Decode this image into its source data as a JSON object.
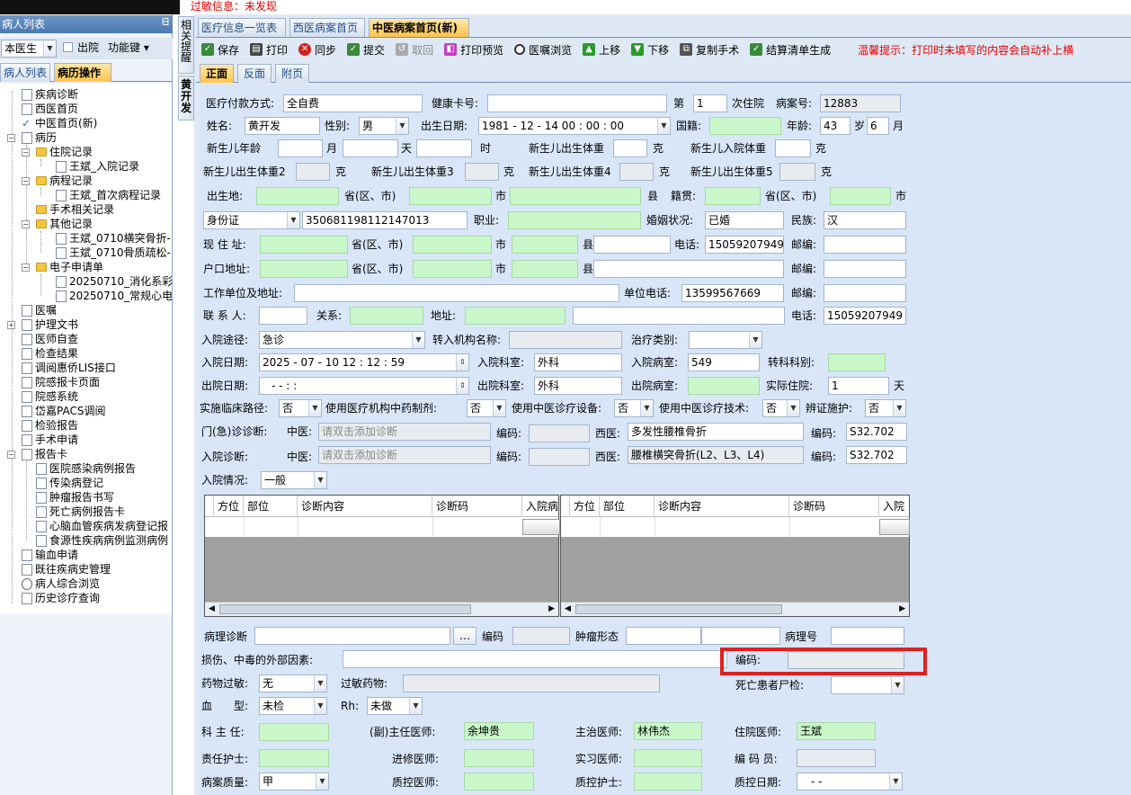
{
  "top": {
    "allergy_info": "过敏信息：未发现"
  },
  "left_panel": {
    "title": "病人列表",
    "doctor_filter": "本医生",
    "discharge_label": "出院",
    "function_key": "功能键",
    "tabs": [
      "病人列表",
      "病历操作"
    ],
    "tree": [
      {
        "label": "疾病诊断"
      },
      {
        "label": "西医首页"
      },
      {
        "label": "中医首页(新)"
      },
      {
        "label": "病历"
      },
      {
        "label": "住院记录"
      },
      {
        "label": "王斌_入院记录"
      },
      {
        "label": "病程记录"
      },
      {
        "label": "王斌_首次病程记录"
      },
      {
        "label": "手术相关记录"
      },
      {
        "label": "其他记录"
      },
      {
        "label": "王斌_0710横突骨折-"
      },
      {
        "label": "王斌_0710骨质疏松-|"
      },
      {
        "label": "电子申请单"
      },
      {
        "label": "20250710_消化系彩超"
      },
      {
        "label": "20250710_常规心电图"
      },
      {
        "label": "医嘱"
      },
      {
        "label": "护理文书"
      },
      {
        "label": "医师自查"
      },
      {
        "label": "检查结果"
      },
      {
        "label": "调阅惠侨LIS接口"
      },
      {
        "label": "院感报卡页面"
      },
      {
        "label": "院感系统"
      },
      {
        "label": "岱嘉PACS调阅"
      },
      {
        "label": "检验报告"
      },
      {
        "label": "手术申请"
      },
      {
        "label": "报告卡"
      },
      {
        "label": "医院感染病例报告"
      },
      {
        "label": "传染病登记"
      },
      {
        "label": "肿瘤报告书写"
      },
      {
        "label": "死亡病例报告卡"
      },
      {
        "label": "心脑血管疾病发病登记报"
      },
      {
        "label": "食源性疾病病例监测病例"
      },
      {
        "label": "输血申请"
      },
      {
        "label": "既往疾病史管理"
      },
      {
        "label": "病人综合浏览"
      },
      {
        "label": "历史诊疗查询"
      }
    ]
  },
  "side_tabs": {
    "related": "相关提醒",
    "patient": "黄开发"
  },
  "doc_tabs": [
    "医疗信息一览表",
    "西医病案首页",
    "中医病案首页(新)"
  ],
  "toolbar": {
    "save": "保存",
    "print": "打印",
    "sync": "同步",
    "submit": "提交",
    "retract": "取回",
    "print_preview": "打印预览",
    "order_browse": "医嘱浏览",
    "move_up": "上移",
    "move_down": "下移",
    "copy_surgery": "复制手术",
    "settlement": "结算清单生成",
    "tip": "温馨提示：打印时未填写的内容会自动补上横"
  },
  "page_tabs": [
    "正面",
    "反面",
    "附页"
  ],
  "form": {
    "payment_label": "医疗付款方式:",
    "payment": "全自费",
    "health_card_label": "健康卡号:",
    "health_card": "",
    "visit_prefix": "第",
    "visit_no": "1",
    "visit_suffix": "次住院",
    "case_no_label": "病案号:",
    "case_no": "12883",
    "name_label": "姓名:",
    "name": "黄开发",
    "sex_label": "性别:",
    "sex": "男",
    "birth_label": "出生日期:",
    "birth": "1981 - 12 - 14   00 : 00 : 00",
    "nationality_label": "国籍:",
    "nationality": "",
    "age_label": "年龄:",
    "age": "43",
    "age_unit": "岁",
    "age_month": "6",
    "month_unit": "月",
    "newborn_age_label": "新生儿年龄",
    "month_label": "月",
    "day_label": "天",
    "hour_label": "时",
    "nb_birth_weight_label": "新生儿出生体重",
    "gram": "克",
    "nb_adm_weight_label": "新生儿入院体重",
    "nb_weight2_label": "新生儿出生体重2",
    "nb_weight3_label": "新生儿出生体重3",
    "nb_weight4_label": "新生儿出生体重4",
    "nb_weight5_label": "新生儿出生体重5",
    "birthplace_label": "出生地:",
    "province_label": "省(区、市)",
    "city_label": "市",
    "county_label": "县",
    "native_label": "籍贯:",
    "id_type": "身份证",
    "id_no": "350681198112147013",
    "occupation_label": "职业:",
    "occupation": "",
    "marital_label": "婚姻状况:",
    "marital": "已婚",
    "ethnicity_label": "民族:",
    "ethnicity": "汉",
    "current_addr_label": "现 住 址:",
    "phone_label": "电话:",
    "phone": "15059207949",
    "postcode_label": "邮编:",
    "hukou_label": "户口地址:",
    "workplace_label": "工作单位及地址:",
    "work_phone_label": "单位电话:",
    "work_phone": "13599567669",
    "contact_label": "联 系 人:",
    "relation_label": "关系:",
    "address_label": "地址:",
    "contact_phone": "15059207949",
    "admission_route_label": "入院途径:",
    "admission_route": "急诊",
    "transfer_inst_label": "转入机构名称:",
    "treatment_type_label": "治疗类别:",
    "admission_date_label": "入院日期:",
    "admission_date": "2025 - 07 - 10   12 : 12 : 59",
    "adm_dept_label": "入院科室:",
    "adm_dept": "外科",
    "adm_ward_label": "入院病室:",
    "adm_ward": "549",
    "transfer_dept_label": "转科科别:",
    "discharge_date_label": "出院日期:",
    "discharge_date": "-    -         :    :",
    "dis_dept_label": "出院科室:",
    "dis_dept": "外科",
    "dis_ward_label": "出院病室:",
    "actual_stay_label": "实际住院:",
    "actual_stay": "1",
    "day_unit": "天",
    "pathway_label": "实施临床路径:",
    "pathway": "否",
    "tcm_drug_label": "使用医疗机构中药制剂:",
    "tcm_drug": "否",
    "tcm_device_label": "使用中医诊疗设备:",
    "tcm_device": "否",
    "tcm_tech_label": "使用中医诊疗技术:",
    "tcm_tech": "否",
    "syndrome_label": "辨证施护:",
    "syndrome": "否",
    "outpatient_diag_label": "门(急)诊诊断:",
    "tcm_label": "中医:",
    "tcm_placeholder": "请双击添加诊断",
    "code_label": "编码:",
    "wm_label": "西医:",
    "outpatient_wm": "多发性腰椎骨折",
    "outpatient_code": "S32.702",
    "admission_diag_label": "入院诊断:",
    "admission_wm": "腰椎横突骨折(L2、L3、L4)",
    "admission_code": "S32.702",
    "admission_condition_label": "入院情况:",
    "admission_condition": "一般",
    "grid_cols": [
      "方位",
      "部位",
      "诊断内容",
      "诊断码",
      "入院病"
    ],
    "grid_cols2": [
      "方位",
      "部位",
      "诊断内容",
      "诊断码",
      "入院"
    ],
    "pathology_label": "病理诊断",
    "code_short": "编码",
    "tumor_label": "肿瘤形态",
    "pathology_no_label": "病理号",
    "injury_label": "损伤、中毒的外部因素:",
    "drug_allergy_label": "药物过敏:",
    "drug_allergy": "无",
    "allergy_drug_label": "过敏药物:",
    "autopsy_label": "死亡患者尸检:",
    "blood_label": "血　　型:",
    "blood": "未检",
    "rh_label": "Rh:",
    "rh": "未做",
    "director_label": "科 主 任:",
    "chief_label": "(副)主任医师:",
    "chief": "余坤贵",
    "attending_label": "主治医师:",
    "attending": "林伟杰",
    "resident_label": "住院医师:",
    "resident": "王斌",
    "nurse_label": "责任护士:",
    "trainee_label": "进修医师:",
    "intern_label": "实习医师:",
    "coder_label": "编 码 员:",
    "quality_label": "病案质量:",
    "quality": "甲",
    "qc_doctor_label": "质控医师:",
    "qc_nurse_label": "质控护士:",
    "qc_date_label": "质控日期:",
    "qc_date": "-    -"
  }
}
